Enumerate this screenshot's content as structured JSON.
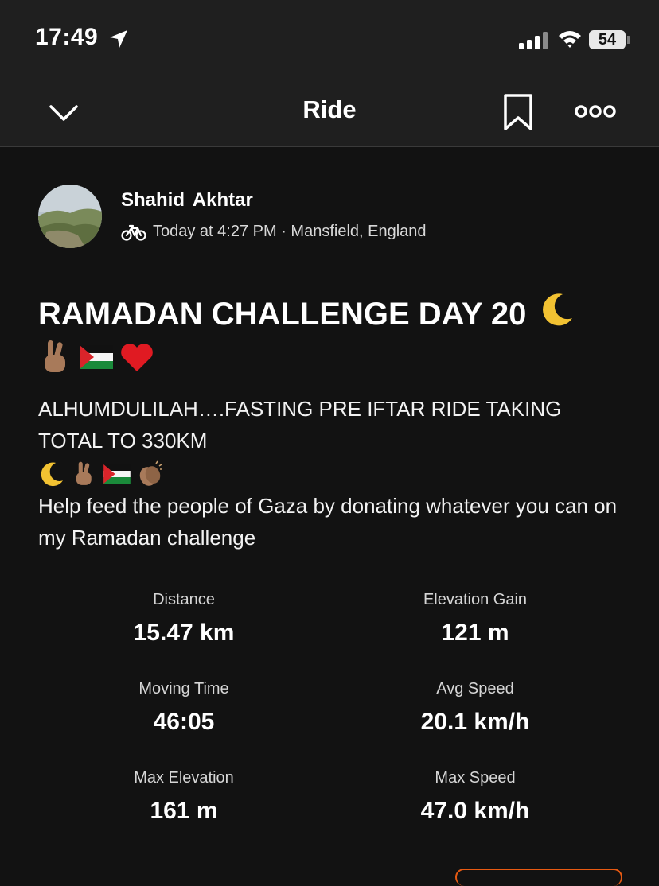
{
  "status_bar": {
    "time": "17:49",
    "battery": "54"
  },
  "nav": {
    "title": "Ride"
  },
  "athlete": {
    "name": "Shahid  Akhtar",
    "meta": "Today at 4:27 PM · Mansfield, England"
  },
  "activity": {
    "title": "RAMADAN CHALLENGE DAY 20",
    "description_line1": "ALHUMDULILAH….FASTING PRE IFTAR RIDE TAKING TOTAL TO 330KM",
    "description_line2": "Help feed the people of Gaza by donating whatever you can on my Ramadan challenge"
  },
  "stats": [
    {
      "label": "Distance",
      "value": "15.47 km"
    },
    {
      "label": "Elevation Gain",
      "value": "121 m"
    },
    {
      "label": "Moving Time",
      "value": "46:05"
    },
    {
      "label": "Avg Speed",
      "value": "20.1 km/h"
    },
    {
      "label": "Max Elevation",
      "value": "161 m"
    },
    {
      "label": "Max Speed",
      "value": "47.0 km/h"
    }
  ],
  "colors": {
    "background": "#121212",
    "bar": "#1f1f1f",
    "accent": "#e85a12"
  },
  "icons": [
    "location-arrow-icon",
    "signal-icon",
    "wifi-icon",
    "chevron-down-icon",
    "bookmark-icon",
    "more-icon",
    "bike-icon"
  ]
}
